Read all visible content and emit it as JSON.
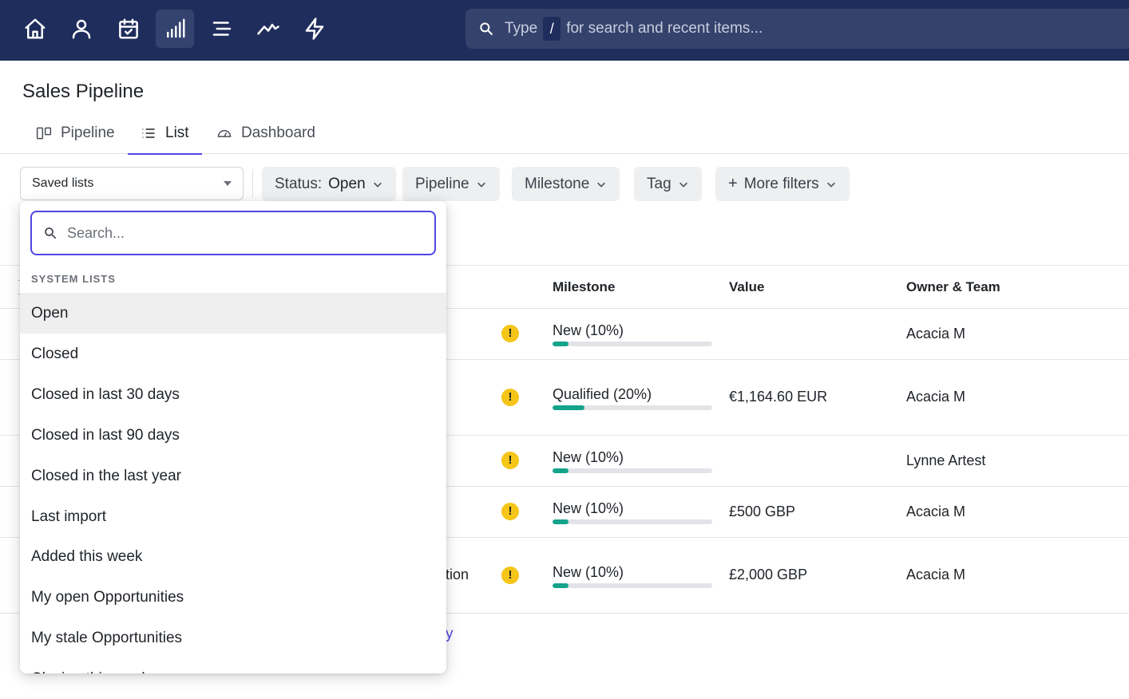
{
  "nav": {
    "icons": [
      "home-icon",
      "user-icon",
      "calendar-icon",
      "pipeline-bars-icon",
      "list-icon",
      "activity-icon",
      "lightning-icon"
    ],
    "search": {
      "prefix": "Type",
      "key": "/",
      "suffix": "for search and recent items..."
    }
  },
  "page": {
    "title": "Sales Pipeline"
  },
  "tabs": [
    {
      "label": "Pipeline",
      "icon": "pipeline-columns-icon"
    },
    {
      "label": "List",
      "icon": "list-icon",
      "active": true
    },
    {
      "label": "Dashboard",
      "icon": "gauge-icon"
    }
  ],
  "filters": {
    "saved_lists": "Saved lists",
    "status_label": "Status:",
    "status_value": "Open",
    "pipeline": "Pipeline",
    "milestone": "Milestone",
    "tag": "Tag",
    "more_filters": "More filters"
  },
  "table": {
    "headers": {
      "milestone": "Milestone",
      "value": "Value",
      "owner": "Owner & Team"
    },
    "rows": [
      {
        "milestone": "New (10%)",
        "progress": 0.1,
        "value": "",
        "owner": "Acacia M",
        "name_fragment": ""
      },
      {
        "milestone": "Qualified (20%)",
        "progress": 0.2,
        "value": "€1,164.60 EUR",
        "owner": "Acacia M",
        "name_fragment": ""
      },
      {
        "milestone": "New (10%)",
        "progress": 0.1,
        "value": "",
        "owner": "Lynne Artest",
        "name_fragment": ""
      },
      {
        "milestone": "New (10%)",
        "progress": 0.1,
        "value": "£500 GBP",
        "owner": "Acacia M",
        "name_fragment": ""
      },
      {
        "milestone": "New (10%)",
        "progress": 0.1,
        "value": "£2,000 GBP",
        "owner": "Acacia M",
        "name_fragment": "tion"
      }
    ],
    "footer_link_fragment": "y"
  },
  "dropdown": {
    "search_placeholder": "Search...",
    "section": "SYSTEM LISTS",
    "items": [
      "Open",
      "Closed",
      "Closed in last 30 days",
      "Closed in last 90 days",
      "Closed in the last year",
      "Last import",
      "Added this week",
      "My open Opportunities",
      "My stale Opportunities",
      "Closing this week"
    ],
    "highlighted_index": 0
  },
  "colors": {
    "nav_bg": "#1e2d5c",
    "accent": "#4f46e5",
    "progress": "#14a38b",
    "warning": "#f5c518"
  }
}
